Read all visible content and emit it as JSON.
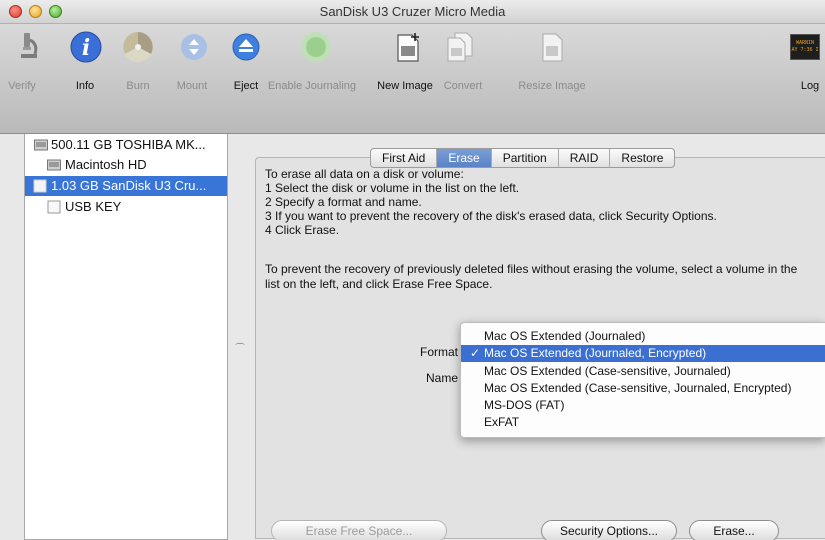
{
  "window": {
    "title": "SanDisk U3 Cruzer Micro Media"
  },
  "toolbar": {
    "items": [
      {
        "label": "Verify",
        "icon": "microscope-icon",
        "enabled": false
      },
      {
        "label": "Info",
        "icon": "info-icon",
        "enabled": true
      },
      {
        "label": "Burn",
        "icon": "burn-icon",
        "enabled": false
      },
      {
        "label": "Mount",
        "icon": "mount-icon",
        "enabled": false
      },
      {
        "label": "Eject",
        "icon": "eject-icon",
        "enabled": true
      },
      {
        "label": "Enable Journaling",
        "icon": "journaling-icon",
        "enabled": false
      },
      {
        "label": "New Image",
        "icon": "new-image-icon",
        "enabled": true
      },
      {
        "label": "Convert",
        "icon": "convert-icon",
        "enabled": false
      },
      {
        "label": "Resize Image",
        "icon": "resize-image-icon",
        "enabled": false
      },
      {
        "label": "Log",
        "icon": "log-icon",
        "enabled": true
      }
    ],
    "log_badge": "WARNIN\nAY 7:36 I"
  },
  "sidebar": {
    "items": [
      {
        "label": "500.11 GB TOSHIBA MK...",
        "level": 0,
        "selected": false
      },
      {
        "label": "Macintosh HD",
        "level": 1,
        "selected": false
      },
      {
        "label": "1.03 GB SanDisk U3 Cru...",
        "level": 0,
        "selected": true
      },
      {
        "label": "USB KEY",
        "level": 1,
        "selected": false
      }
    ]
  },
  "tabs": [
    {
      "label": "First Aid",
      "active": false
    },
    {
      "label": "Erase",
      "active": true
    },
    {
      "label": "Partition",
      "active": false
    },
    {
      "label": "RAID",
      "active": false
    },
    {
      "label": "Restore",
      "active": false
    }
  ],
  "erase": {
    "instructions": [
      "To erase all data on a disk or volume:",
      "1 Select the disk or volume in the list on the left.",
      "2 Specify a format and name.",
      "3 If you want to prevent the recovery of the disk's erased data, click Security Options.",
      "4 Click Erase."
    ],
    "free_space_note": "To prevent the recovery of previously deleted files without erasing the volume, select a volume in the list on the left, and click Erase Free Space.",
    "format_label": "Format",
    "name_label": "Name",
    "format_options": [
      "Mac OS Extended (Journaled)",
      "Mac OS Extended (Journaled, Encrypted)",
      "Mac OS Extended (Case-sensitive, Journaled)",
      "Mac OS Extended (Case-sensitive, Journaled, Encrypted)",
      "MS-DOS (FAT)",
      "ExFAT"
    ],
    "selected_format_index": 1,
    "check_mark": "✓",
    "erase_free_space_label": "Erase Free Space...",
    "security_options_label": "Security Options...",
    "erase_label": "Erase..."
  }
}
